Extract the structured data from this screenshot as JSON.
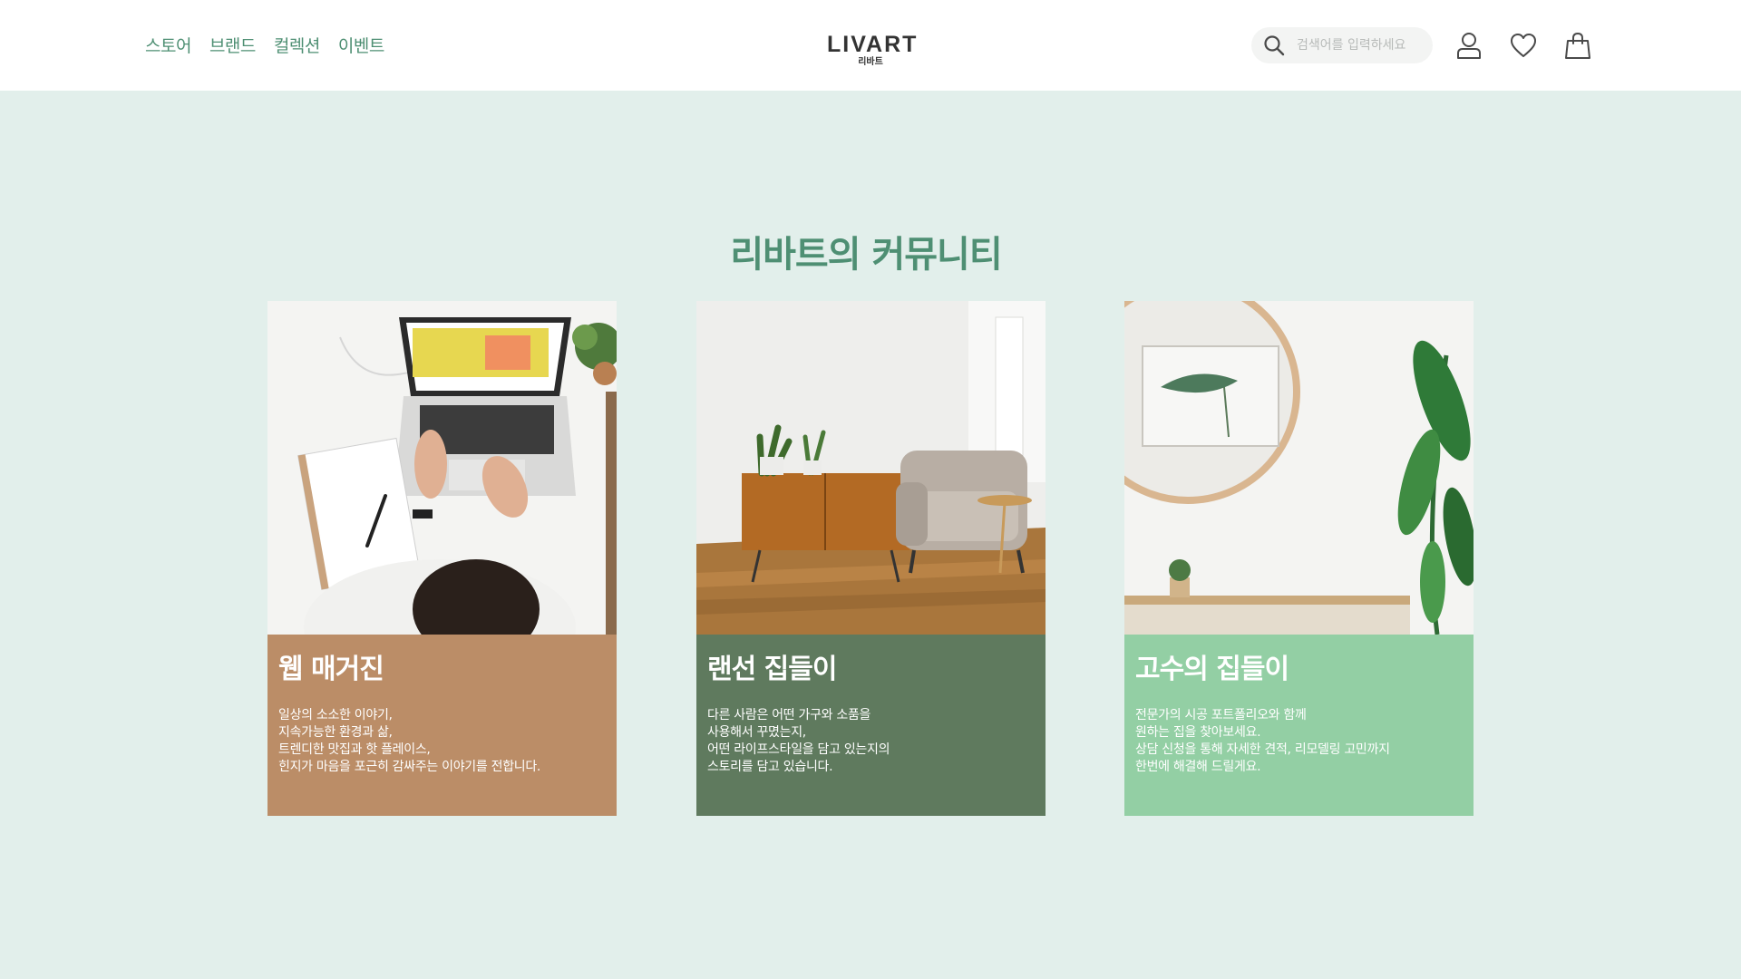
{
  "header": {
    "nav": [
      "스토어",
      "브랜드",
      "컬렉션",
      "이벤트"
    ],
    "logo": {
      "main": "LIVART",
      "sub": "리바트"
    },
    "search": {
      "placeholder": "검색어를 입력하세요"
    },
    "icons": [
      "search-icon",
      "user-icon",
      "heart-icon",
      "shopping-bag-icon"
    ]
  },
  "main": {
    "title": "리바트의 커뮤니티",
    "cards": [
      {
        "title": "웹 매거진",
        "desc": "일상의 소소한 이야기,\n지속가능한 환경과 삶,\n트렌디한 맛집과 핫 플레이스,\n힌지가 마음을 포근히 감싸주는 이야기를 전합니다.",
        "color": "#bb8d67",
        "image": "laptop-desk-photo"
      },
      {
        "title": "랜선 집들이",
        "desc": "다른 사람은 어떤 가구와 소품을\n사용해서 꾸몄는지,\n어떤 라이프스타일을 담고 있는지의\n스토리를 담고 있습니다.",
        "color": "#5f7a5e",
        "image": "living-room-armchair-photo"
      },
      {
        "title": "고수의 집들이",
        "desc": "전문가의 시공 포트폴리오와 함께\n원하는 집을 찾아보세요.\n상담 신청을 통해 자세한 견적, 리모델링 고민까지\n한번에 해결해 드릴게요.",
        "color": "#93cfa4",
        "image": "mirror-plant-photo"
      }
    ]
  },
  "colors": {
    "accent": "#4e8f73",
    "background": "#e2efeb",
    "header": "#ffffff"
  }
}
